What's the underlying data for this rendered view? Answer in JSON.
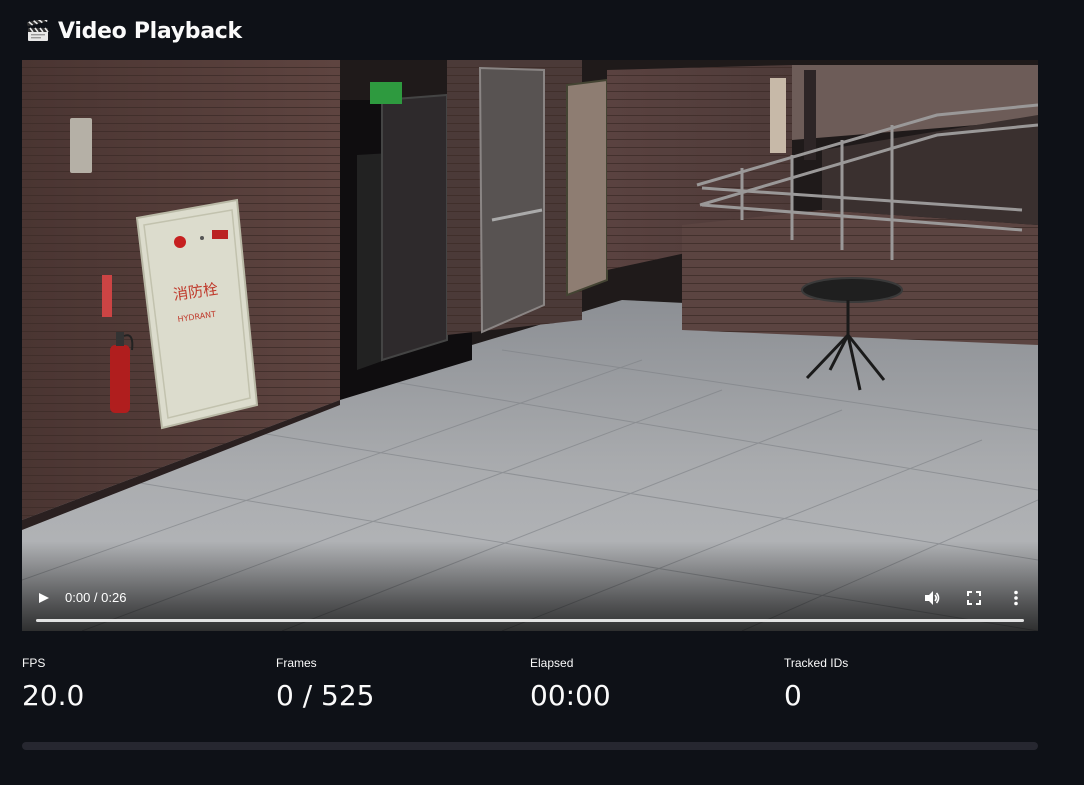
{
  "header": {
    "icon": "clapperboard-icon",
    "title": "Video Playback"
  },
  "player": {
    "current_time": "0:00",
    "duration": "0:26",
    "time_display": "0:00 / 0:26",
    "progress": 0,
    "scene": {
      "hydrant_text_zh": "消防栓",
      "hydrant_text_en": "HYDRANT"
    },
    "icons": {
      "play": "play-icon",
      "volume": "volume-icon",
      "fullscreen": "fullscreen-icon",
      "more": "more-options-icon"
    }
  },
  "metrics": [
    {
      "label": "FPS",
      "value": "20.0"
    },
    {
      "label": "Frames",
      "value": "0 / 525"
    },
    {
      "label": "Elapsed",
      "value": "00:00"
    },
    {
      "label": "Tracked IDs",
      "value": "0"
    }
  ],
  "progress_bar": {
    "value": 0,
    "color": "#ff4b4b",
    "track_color": "#262730"
  },
  "colors": {
    "background": "#0e1117",
    "text": "#fafafa"
  }
}
